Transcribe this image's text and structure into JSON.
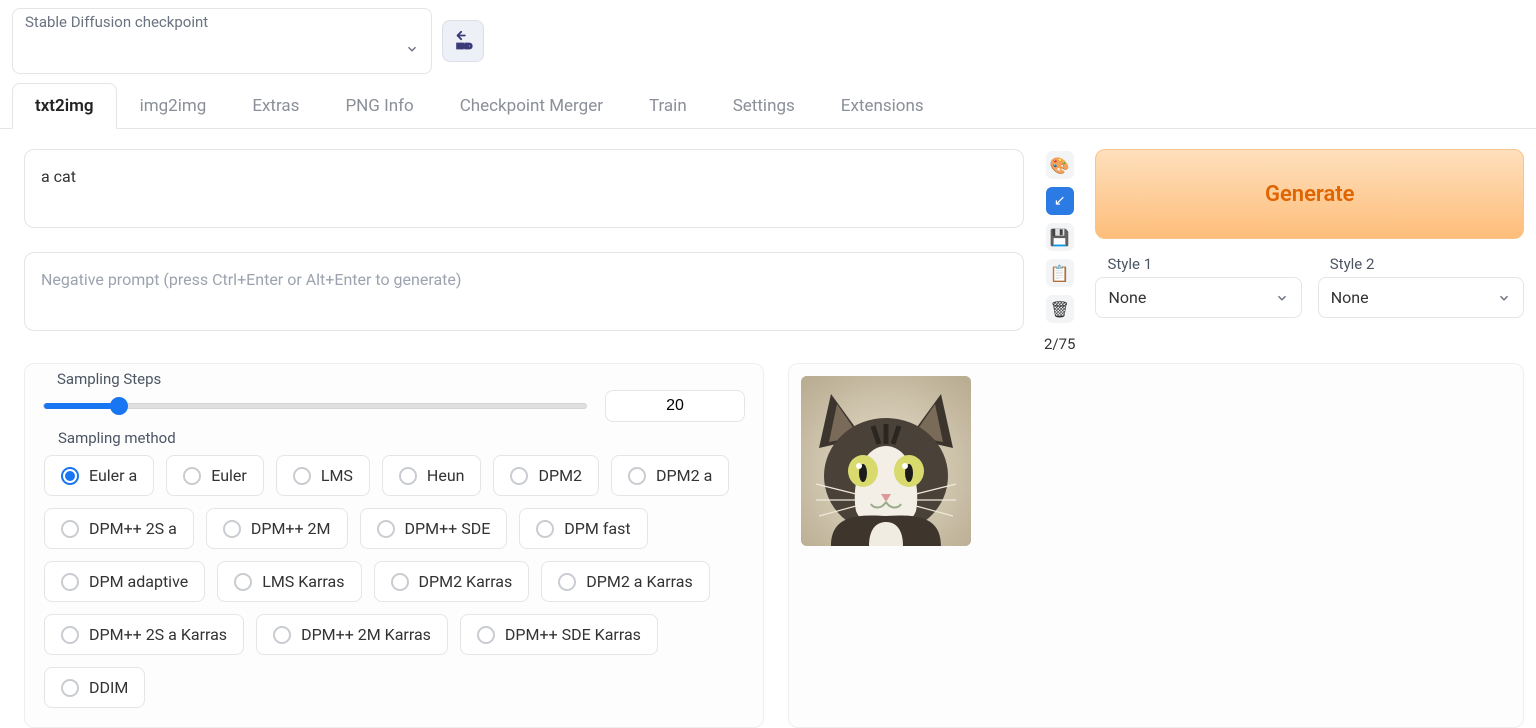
{
  "checkpoint": {
    "label": "Stable Diffusion checkpoint",
    "value": ""
  },
  "tabs": [
    "txt2img",
    "img2img",
    "Extras",
    "PNG Info",
    "Checkpoint Merger",
    "Train",
    "Settings",
    "Extensions"
  ],
  "active_tab": 0,
  "prompt": {
    "value": "a cat",
    "neg_placeholder": "Negative prompt (press Ctrl+Enter or Alt+Enter to generate)"
  },
  "token_count": "2/75",
  "generate_label": "Generate",
  "styles": {
    "style1": {
      "label": "Style 1",
      "value": "None"
    },
    "style2": {
      "label": "Style 2",
      "value": "None"
    }
  },
  "sampling_steps": {
    "label": "Sampling Steps",
    "value": "20"
  },
  "sampling_method": {
    "label": "Sampling method",
    "selected": "Euler a",
    "options": [
      "Euler a",
      "Euler",
      "LMS",
      "Heun",
      "DPM2",
      "DPM2 a",
      "DPM++ 2S a",
      "DPM++ 2M",
      "DPM++ SDE",
      "DPM fast",
      "DPM adaptive",
      "LMS Karras",
      "DPM2 Karras",
      "DPM2 a Karras",
      "DPM++ 2S a Karras",
      "DPM++ 2M Karras",
      "DPM++ SDE Karras",
      "DDIM"
    ]
  },
  "tool_icons": {
    "palette": "🎨",
    "arrow": "↙",
    "save": "💾",
    "clipboard": "📋",
    "trash": "🗑"
  }
}
